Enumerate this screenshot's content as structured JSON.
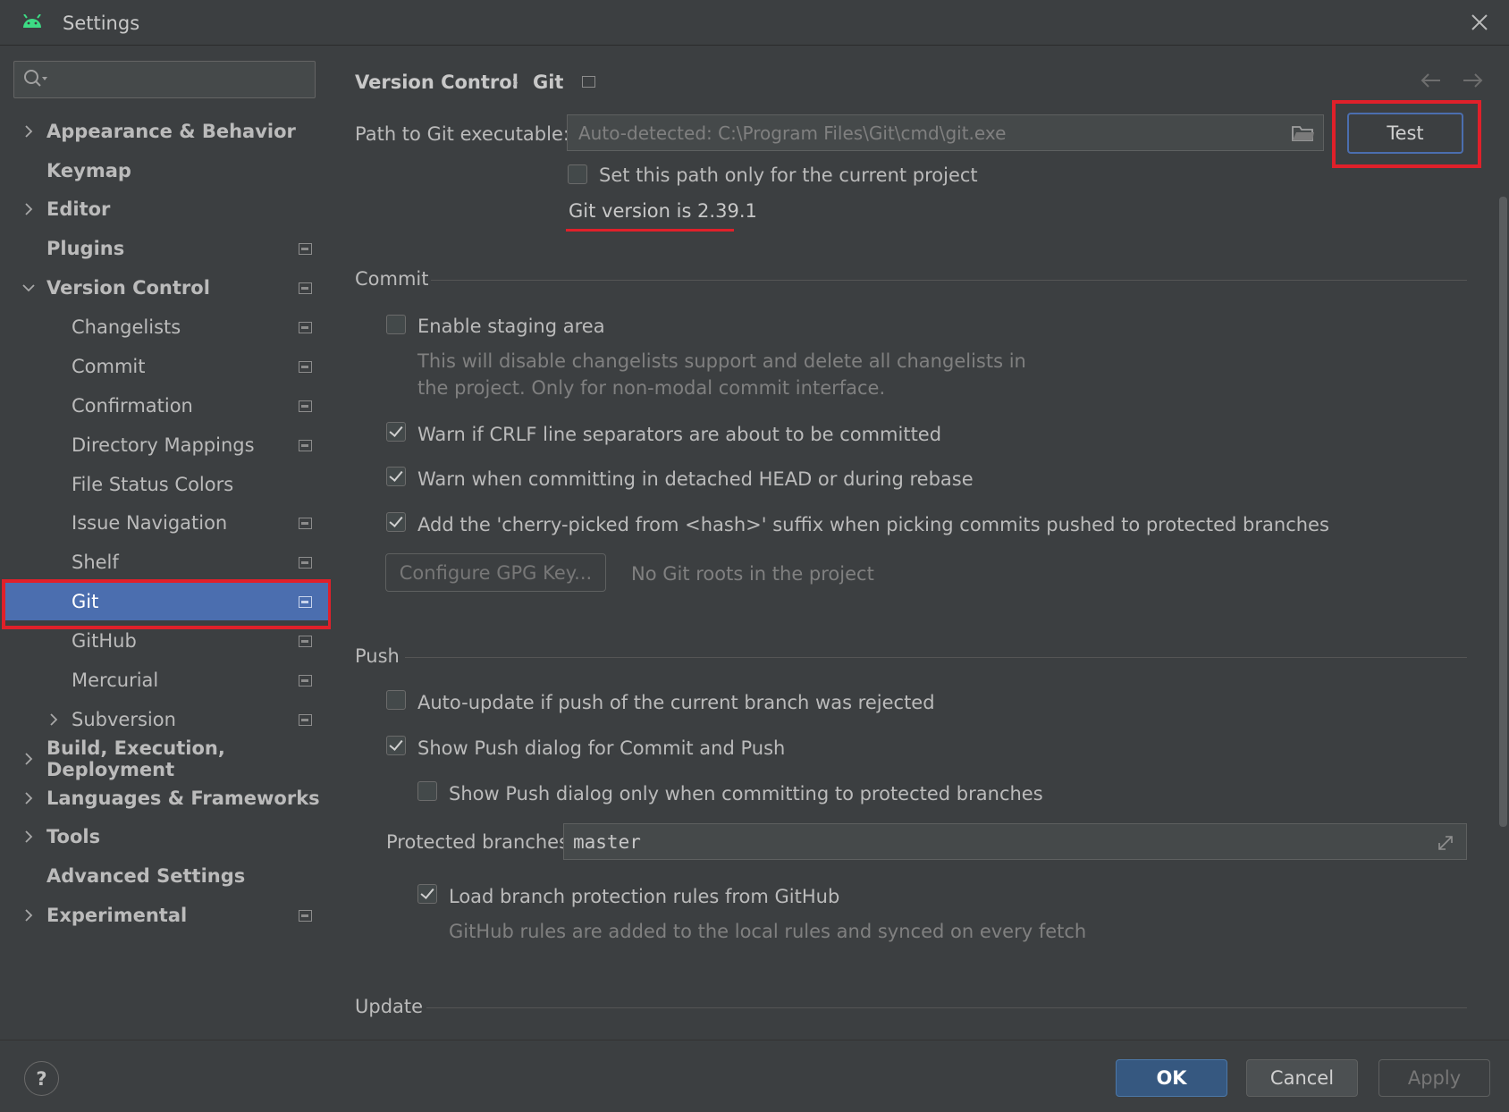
{
  "window": {
    "title": "Settings"
  },
  "sidebar": {
    "search_placeholder": "",
    "items": [
      {
        "label": "Appearance & Behavior",
        "bold": true,
        "chevron": "right",
        "pin": false
      },
      {
        "label": "Keymap",
        "bold": true,
        "chevron": "none",
        "pin": false
      },
      {
        "label": "Editor",
        "bold": true,
        "chevron": "right",
        "pin": false
      },
      {
        "label": "Plugins",
        "bold": true,
        "chevron": "none",
        "pin": true
      },
      {
        "label": "Version Control",
        "bold": true,
        "chevron": "down",
        "pin": true
      },
      {
        "label": "Changelists",
        "bold": false,
        "chevron": "none",
        "pin": true
      },
      {
        "label": "Commit",
        "bold": false,
        "chevron": "none",
        "pin": true
      },
      {
        "label": "Confirmation",
        "bold": false,
        "chevron": "none",
        "pin": true
      },
      {
        "label": "Directory Mappings",
        "bold": false,
        "chevron": "none",
        "pin": true
      },
      {
        "label": "File Status Colors",
        "bold": false,
        "chevron": "none",
        "pin": false
      },
      {
        "label": "Issue Navigation",
        "bold": false,
        "chevron": "none",
        "pin": true
      },
      {
        "label": "Shelf",
        "bold": false,
        "chevron": "none",
        "pin": true
      },
      {
        "label": "Git",
        "bold": false,
        "chevron": "none",
        "pin": true,
        "selected": true
      },
      {
        "label": "GitHub",
        "bold": false,
        "chevron": "none",
        "pin": true
      },
      {
        "label": "Mercurial",
        "bold": false,
        "chevron": "none",
        "pin": true
      },
      {
        "label": "Subversion",
        "bold": false,
        "chevron": "right",
        "pin": true
      },
      {
        "label": "Build, Execution, Deployment",
        "bold": true,
        "chevron": "right",
        "pin": false
      },
      {
        "label": "Languages & Frameworks",
        "bold": true,
        "chevron": "right",
        "pin": false
      },
      {
        "label": "Tools",
        "bold": true,
        "chevron": "right",
        "pin": false
      },
      {
        "label": "Advanced Settings",
        "bold": true,
        "chevron": "none",
        "pin": false
      },
      {
        "label": "Experimental",
        "bold": true,
        "chevron": "right",
        "pin": true
      }
    ]
  },
  "breadcrumb": {
    "parent": "Version Control",
    "separator": "›",
    "current": "Git"
  },
  "git_path": {
    "label": "Path to Git executable:",
    "placeholder": "Auto-detected: C:\\Program Files\\Git\\cmd\\git.exe",
    "test_label": "Test",
    "current_project_only": {
      "label": "Set this path only for the current project",
      "checked": false
    },
    "version_text": "Git version is 2.39.1"
  },
  "commit": {
    "header": "Commit",
    "staging": {
      "label": "Enable staging area",
      "checked": false
    },
    "staging_desc_1": "This will disable changelists support and delete all changelists in",
    "staging_desc_2": "the project. Only for non-modal commit interface.",
    "warn_crlf": {
      "label": "Warn if CRLF line separators are about to be committed",
      "checked": true
    },
    "warn_detached": {
      "label": "Warn when committing in detached HEAD or during rebase",
      "checked": true
    },
    "cherry_pick": {
      "label": "Add the 'cherry-picked from <hash>' suffix when picking commits pushed to protected branches",
      "checked": true
    },
    "gpg_button": "Configure GPG Key...",
    "gpg_status": "No Git roots in the project"
  },
  "push": {
    "header": "Push",
    "auto_update": {
      "label": "Auto-update if push of the current branch was rejected",
      "checked": false
    },
    "show_push_dialog": {
      "label": "Show Push dialog for Commit and Push",
      "checked": true
    },
    "push_dialog_protected": {
      "label": "Show Push dialog only when committing to protected branches",
      "checked": false
    },
    "protected_label": "Protected branches:",
    "protected_value": "master",
    "load_rules": {
      "label": "Load branch protection rules from GitHub",
      "checked": true
    },
    "load_rules_desc": "GitHub rules are added to the local rules and synced on every fetch"
  },
  "update": {
    "header": "Update"
  },
  "footer": {
    "help": "?",
    "ok": "OK",
    "cancel": "Cancel",
    "apply": "Apply"
  },
  "colors": {
    "accent": "#4b6eaf",
    "highlight_red": "#e0202a",
    "background": "#3c3f41"
  }
}
